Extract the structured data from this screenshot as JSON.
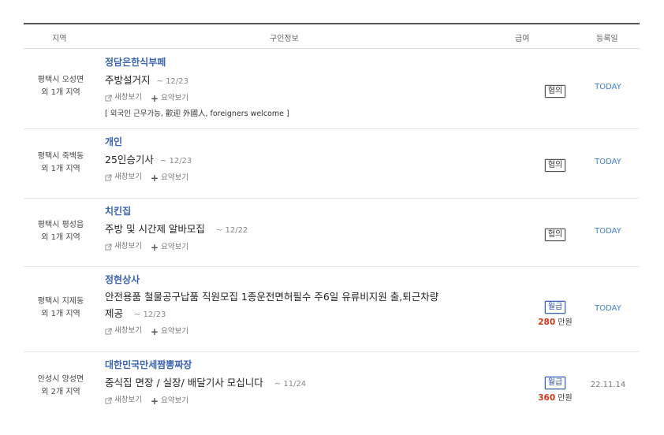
{
  "header": {
    "region": "지역",
    "info": "구인정보",
    "pay": "급여",
    "reg": "등록일"
  },
  "action_labels": {
    "new_window": "새창보기",
    "summary": "요약보기"
  },
  "rows": [
    {
      "region_line1": "평택시 오성면",
      "region_line2": "외 1개 지역",
      "company": "정담은한식부페",
      "title": "주방설거지",
      "title2": "",
      "date": "~ 12/23",
      "note": "[ 외국인 근무가능, 歡迎 外國人, foreigners welcome ]",
      "pay_type": "협의",
      "pay_amount": "",
      "pay_unit": "",
      "registered": "TODAY"
    },
    {
      "region_line1": "평택시 죽백동",
      "region_line2": "외 1개 지역",
      "company": "개인",
      "title": "25인승기사",
      "title2": "",
      "date": "~ 12/23",
      "note": "",
      "pay_type": "협의",
      "pay_amount": "",
      "pay_unit": "",
      "registered": "TODAY"
    },
    {
      "region_line1": "평택시 평성읍",
      "region_line2": "외 1개 지역",
      "company": "치킨집",
      "title": "주방 및 시간제 알바모집",
      "title2": "",
      "date": "~ 12/22",
      "note": "",
      "pay_type": "협의",
      "pay_amount": "",
      "pay_unit": "",
      "registered": "TODAY"
    },
    {
      "region_line1": "평택시 지제동",
      "region_line2": "외 1개 지역",
      "company": "정현상사",
      "title": "안전용품 철물공구납품 직원모집 1종운전면허필수 주6일 유류비지원 출,퇴근차량",
      "title2": "제공",
      "date": "~ 12/23",
      "note": "",
      "pay_type": "월급",
      "pay_amount": "280",
      "pay_unit": "만원",
      "registered": "TODAY"
    },
    {
      "region_line1": "안성시 양성면",
      "region_line2": "외 2개 지역",
      "company": "대한민국만세짬뽕짜장",
      "title": "중식집 면장 / 실장/ 배달기사 모십니다",
      "title2": "",
      "date": "~ 11/24",
      "note": "",
      "pay_type": "월급",
      "pay_amount": "360",
      "pay_unit": "만원",
      "registered": "22.11.14"
    }
  ],
  "colors": {
    "company": "#3a64b4",
    "today": "#3f7ec6",
    "amount": "#cc3a18"
  }
}
